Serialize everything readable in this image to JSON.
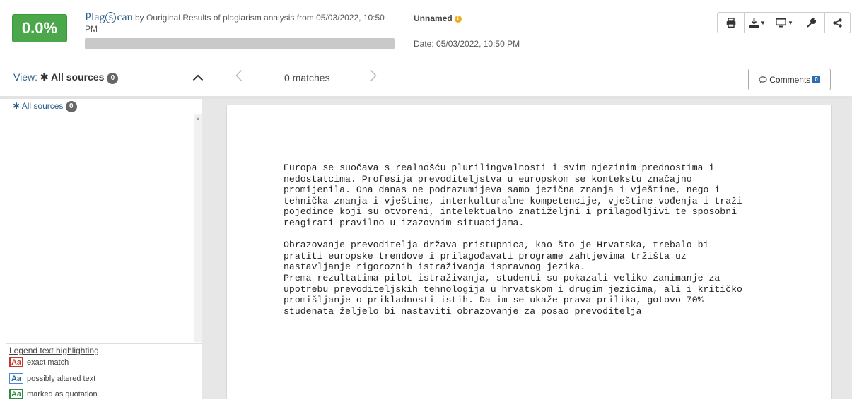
{
  "header": {
    "score": "0.0%",
    "score_percent": 0.0,
    "brand_pre": "Plag",
    "brand_s": "S",
    "brand_post": "can",
    "brand_by": " by Ouriginal",
    "results_text": " Results of plagiarism analysis from 05/03/2022, 10:50 PM",
    "doc_name": "Unnamed",
    "doc_date": "Date: 05/03/2022, 10:50 PM",
    "toolbar": [
      "print-icon",
      "download-icon",
      "monitor-icon",
      "wrench-icon",
      "share-icon"
    ]
  },
  "viewbar": {
    "view_prefix": "View: ",
    "view_star": "✱",
    "view_label": "All sources",
    "view_count": "0",
    "matches": "0 matches",
    "comments_label": "Comments",
    "comments_count": "0"
  },
  "left_panel": {
    "all_sources_label": "All sources",
    "all_sources_count": "0",
    "legend_title": "Legend text highlighting",
    "legend": [
      {
        "swatch": "Aa",
        "label": "exact match",
        "color": "#c0392b"
      },
      {
        "swatch": "Aa",
        "label": "possibly altered text",
        "color": "#4a8ad4"
      },
      {
        "swatch": "Aa",
        "label": "marked as quotation",
        "color": "#2e8b3e"
      }
    ]
  },
  "document": {
    "paragraph1": "Europa se suočava s realnošću plurilingvalnosti i svim njezinim prednostima i\nnedostatcima. Profesija prevoditeljstva u europskom se kontekstu značajno\npromijenila. Ona danas ne podrazumijeva samo jezična znanja i vještine, nego i\ntehnička znanja i vještine, interkulturalne kompetencije, vještine vođenja i traži\npojedince koji su otvoreni, intelektualno znatiželjni i prilagodljivi te sposobni\nreagirati pravilno u izazovnim situacijama.",
    "paragraph2": "Obrazovanje prevoditelja država pristupnica, kao što je Hrvatska, trebalo bi\npratiti europske trendove i prilagođavati programe zahtjevima tržišta uz\nnastavljanje rigoroznih istraživanja ispravnog jezika.\nPrema rezultatima pilot-istraživanja, studenti su pokazali veliko zanimanje za\nupotrebu prevoditeljskih tehnologija u hrvatskom i drugim jezicima, ali i kritičko\npromišljanje o prikladnosti istih. Da im se ukaže prava prilika, gotovo 70%\nstudenata željelo bi nastaviti obrazovanje za posao prevoditelja"
  },
  "colors": {
    "score_green": "#4aa84b",
    "link_blue": "#2b5d8a",
    "info_orange": "#f0ad1a"
  }
}
